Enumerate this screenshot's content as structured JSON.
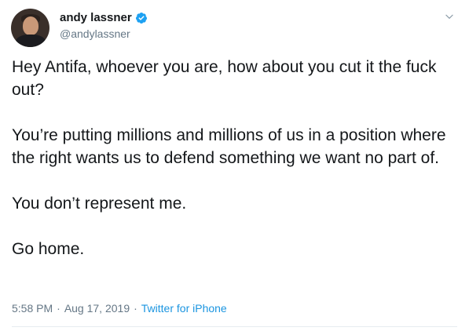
{
  "author": {
    "display_name": "andy lassner",
    "handle": "@andylassner",
    "verified": true,
    "avatar_icon": "user-avatar-photo"
  },
  "tweet": {
    "paragraphs": [
      "Hey Antifa, whoever you are, how about you cut it the fuck out?",
      "You’re putting millions and millions of us in a position where the right wants us to defend something we want no part of.",
      "You don’t represent me.",
      "Go home."
    ]
  },
  "meta": {
    "time": "5:58 PM",
    "date": "Aug 17, 2019",
    "separator": "·",
    "source": "Twitter for iPhone"
  },
  "colors": {
    "text": "#14171a",
    "secondary": "#657786",
    "link": "#1b95e0",
    "verified": "#1da1f2"
  },
  "icons": {
    "verified": "verified-badge-icon",
    "menu": "chevron-down-icon"
  }
}
